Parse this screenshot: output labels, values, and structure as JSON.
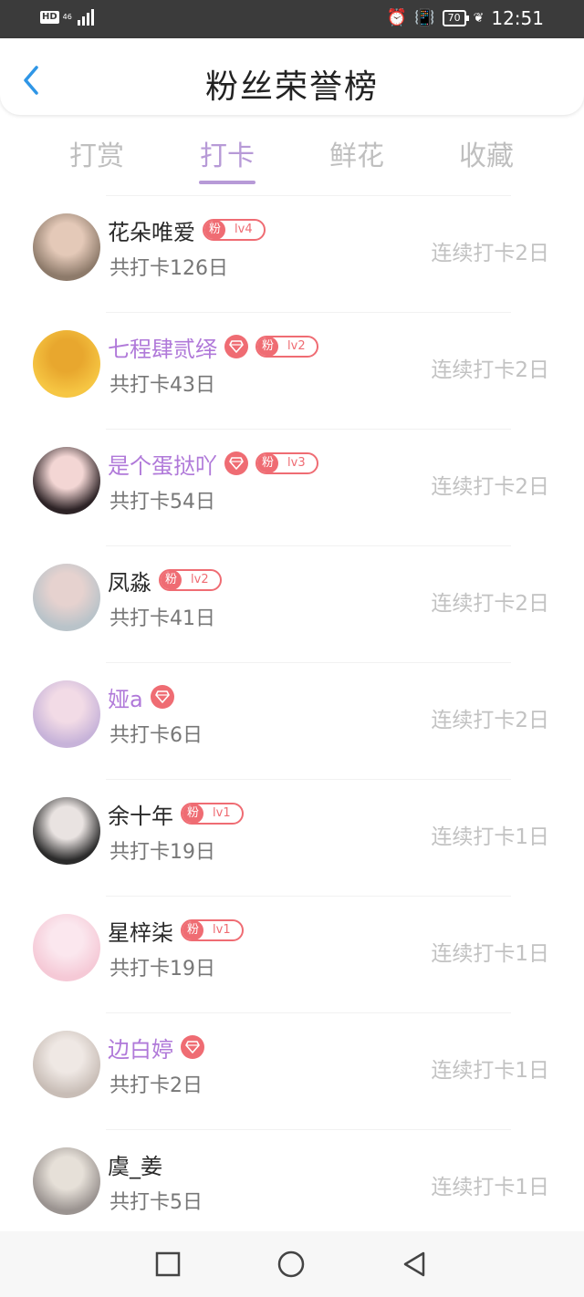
{
  "status_bar": {
    "hd": "HD",
    "network": "46",
    "battery": "70",
    "time": "12:51",
    "icons": [
      "alarm-icon",
      "vibrate-icon",
      "leaf-icon"
    ]
  },
  "header": {
    "title": "粉丝荣誉榜",
    "back_icon": "chevron-left-icon",
    "accent": "#2f96e6"
  },
  "tabs": [
    {
      "label": "打赏",
      "active": false
    },
    {
      "label": "打卡",
      "active": true
    },
    {
      "label": "鲜花",
      "active": false
    },
    {
      "label": "收藏",
      "active": false
    }
  ],
  "colors": {
    "active_tab": "#b79ad7",
    "vip_name": "#b079d9",
    "badge": "#ef6c73",
    "muted": "#c2c2c2"
  },
  "fan_badge_char": "粉",
  "rows": [
    {
      "name": "花朵唯爱",
      "vip": false,
      "gem": false,
      "lv": "lv4",
      "total": "共打卡126日",
      "streak": "连续打卡2日"
    },
    {
      "name": "七程肆贰绎",
      "vip": true,
      "gem": true,
      "lv": "lv2",
      "total": "共打卡43日",
      "streak": "连续打卡2日"
    },
    {
      "name": "是个蛋挞吖",
      "vip": true,
      "gem": true,
      "lv": "lv3",
      "total": "共打卡54日",
      "streak": "连续打卡2日"
    },
    {
      "name": "凤淼",
      "vip": false,
      "gem": false,
      "lv": "lv2",
      "total": "共打卡41日",
      "streak": "连续打卡2日"
    },
    {
      "name": "娅a",
      "vip": true,
      "gem": true,
      "lv": "",
      "total": "共打卡6日",
      "streak": "连续打卡2日"
    },
    {
      "name": "余十年",
      "vip": false,
      "gem": false,
      "lv": "lv1",
      "total": "共打卡19日",
      "streak": "连续打卡1日"
    },
    {
      "name": "星梓柒",
      "vip": false,
      "gem": false,
      "lv": "lv1",
      "total": "共打卡19日",
      "streak": "连续打卡1日"
    },
    {
      "name": "边白婷",
      "vip": true,
      "gem": true,
      "lv": "",
      "total": "共打卡2日",
      "streak": "连续打卡1日"
    },
    {
      "name": "虞_姜",
      "vip": false,
      "gem": false,
      "lv": "",
      "total": "共打卡5日",
      "streak": "连续打卡1日"
    }
  ],
  "nav_bar": [
    "recents-square-icon",
    "home-circle-icon",
    "back-triangle-icon"
  ]
}
